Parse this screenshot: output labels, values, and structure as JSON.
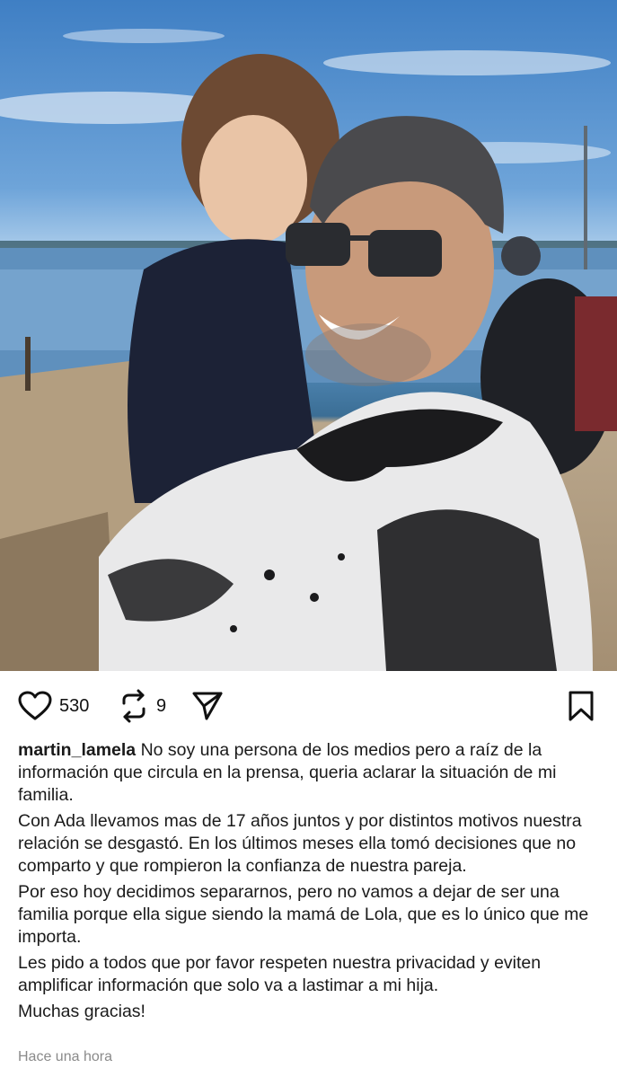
{
  "post": {
    "photo": {
      "icon": "photo-of-man-and-girl-by-the-sea"
    },
    "likes": "530",
    "reposts": "9",
    "username": "martin_lamela",
    "caption_first": "No soy una persona de los medios pero a raíz de la información que circula en la prensa, queria aclarar la situación de mi familia.",
    "paragraphs": [
      "Con Ada llevamos mas de 17 años juntos y por distintos motivos nuestra relación se desgastó. En los últimos meses ella tomó decisiones que no comparto y que rompieron la confianza de nuestra pareja.",
      "Por eso hoy decidimos separarnos, pero no vamos a dejar de ser una familia porque ella sigue siendo la mamá de Lola, que es lo único que me importa.",
      "Les pido a todos que por favor respeten nuestra privacidad y eviten amplificar información que solo va a lastimar a mi hija.",
      "Muchas gracias!"
    ],
    "timestamp": "Hace una hora"
  },
  "icons": {
    "like": "heart-icon",
    "repost": "repost-icon",
    "share": "send-icon",
    "save": "bookmark-icon"
  }
}
